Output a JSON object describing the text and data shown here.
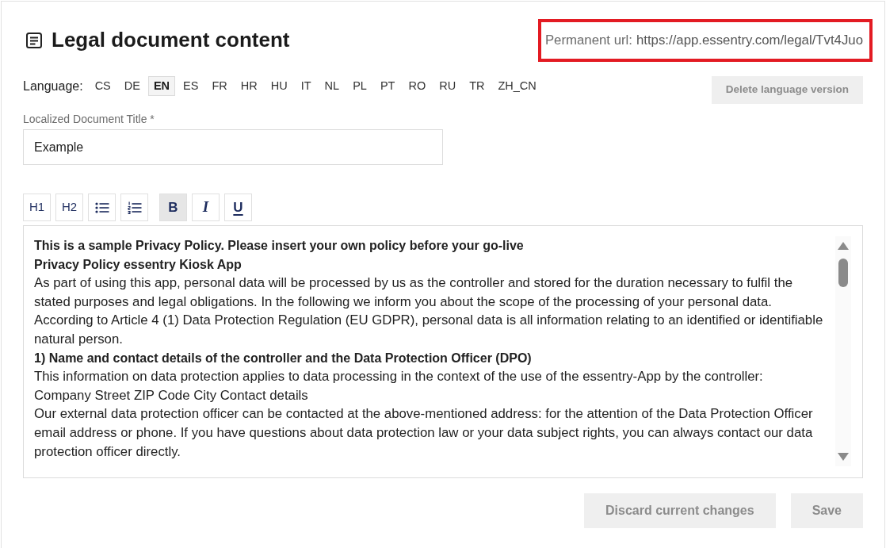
{
  "header": {
    "title": "Legal document content",
    "permanent_url": {
      "label": "Permanent url:",
      "url": "https://app.essentry.com/legal/Tvt4Juo",
      "highlighted": true
    }
  },
  "language_bar": {
    "label": "Language:",
    "options": [
      {
        "code": "CS",
        "selected": false
      },
      {
        "code": "DE",
        "selected": false
      },
      {
        "code": "EN",
        "selected": true
      },
      {
        "code": "ES",
        "selected": false
      },
      {
        "code": "FR",
        "selected": false
      },
      {
        "code": "HR",
        "selected": false
      },
      {
        "code": "HU",
        "selected": false
      },
      {
        "code": "IT",
        "selected": false
      },
      {
        "code": "NL",
        "selected": false
      },
      {
        "code": "PL",
        "selected": false
      },
      {
        "code": "PT",
        "selected": false
      },
      {
        "code": "RO",
        "selected": false
      },
      {
        "code": "RU",
        "selected": false
      },
      {
        "code": "TR",
        "selected": false
      },
      {
        "code": "ZH_CN",
        "selected": false
      }
    ]
  },
  "delete_button": {
    "label": "Delete language version",
    "disabled": true
  },
  "title_field": {
    "label": "Localized Document Title",
    "required_mark": "*",
    "value": "Example"
  },
  "editor": {
    "toolbar_groups": [
      {
        "buttons": [
          {
            "kind": "text",
            "label": "H1",
            "active": false
          },
          {
            "kind": "text",
            "label": "H2",
            "active": false
          },
          {
            "kind": "bullet-list",
            "active": false
          },
          {
            "kind": "numbered-list",
            "active": false
          }
        ]
      },
      {
        "buttons": [
          {
            "kind": "bold",
            "label": "B",
            "active": true
          },
          {
            "kind": "italic",
            "label": "I",
            "active": false
          },
          {
            "kind": "underline",
            "label": "U",
            "active": false
          }
        ]
      }
    ],
    "paragraphs": [
      {
        "kind": "heading",
        "text": "This is a sample Privacy Policy. Please insert your own policy before your go-live"
      },
      {
        "kind": "heading",
        "text": "Privacy Policy essentry Kiosk App"
      },
      {
        "kind": "text",
        "text": "As part of using this app, personal data will be processed by us as the controller and stored for the duration necessary to fulfil the stated purposes and legal obligations. In the following we inform you about the scope of the processing of your personal data."
      },
      {
        "kind": "text",
        "text": "According to Article 4 (1) Data Protection Regulation (EU GDPR), personal data is all information relating to an identified or identifiable natural person."
      },
      {
        "kind": "heading",
        "text": "1) Name and contact details of the controller and the Data Protection Officer (DPO)"
      },
      {
        "kind": "text",
        "text": "This information on data protection applies to data processing in the context of the use of the essentry-App by the controller:"
      },
      {
        "kind": "text",
        "text": "Company Street ZIP Code City Contact details"
      },
      {
        "kind": "text",
        "text": "Our external data protection officer can be contacted at the above-mentioned address: for the attention of the Data Protection Officer email address or phone. If you have questions about data protection law or your data subject rights, you can always contact our data protection officer directly."
      }
    ]
  },
  "footer_buttons": [
    {
      "label": "Discard current changes",
      "disabled": true
    },
    {
      "label": "Save",
      "disabled": true
    }
  ]
}
